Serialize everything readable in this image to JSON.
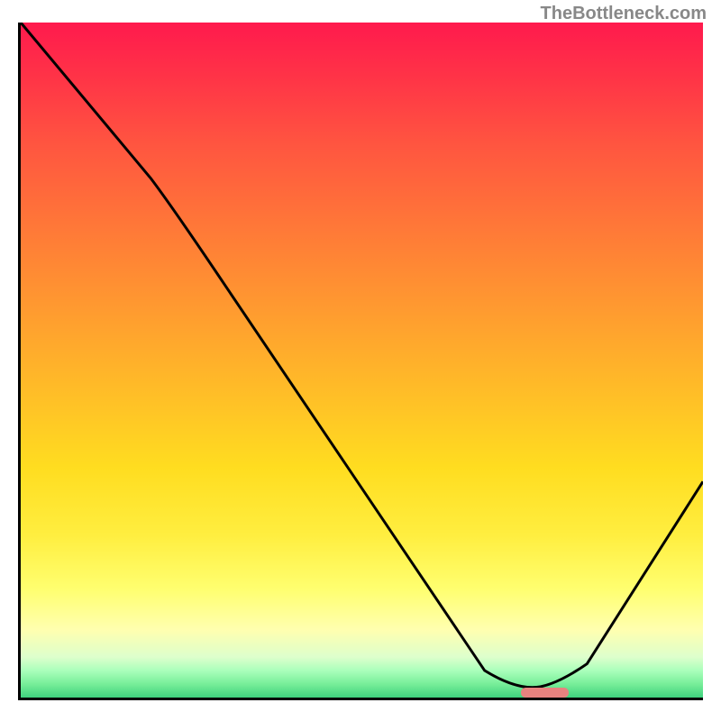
{
  "watermark": "TheBottleneck.com",
  "chart_data": {
    "type": "line",
    "title": "",
    "xlabel": "",
    "ylabel": "",
    "xlim": [
      0,
      100
    ],
    "ylim": [
      0,
      100
    ],
    "curve_points": [
      {
        "x": 0,
        "y": 100
      },
      {
        "x": 19,
        "y": 77
      },
      {
        "x": 22,
        "y": 73
      },
      {
        "x": 68,
        "y": 4
      },
      {
        "x": 72,
        "y": 1.5
      },
      {
        "x": 78,
        "y": 1.5
      },
      {
        "x": 83,
        "y": 5
      },
      {
        "x": 100,
        "y": 32
      }
    ],
    "marker": {
      "x_start": 73,
      "x_end": 80,
      "y": 1.2
    },
    "gradient_colors": {
      "red": "#ff1a4d",
      "orange": "#ff9930",
      "yellow": "#ffff70",
      "green": "#3fd17d"
    }
  }
}
